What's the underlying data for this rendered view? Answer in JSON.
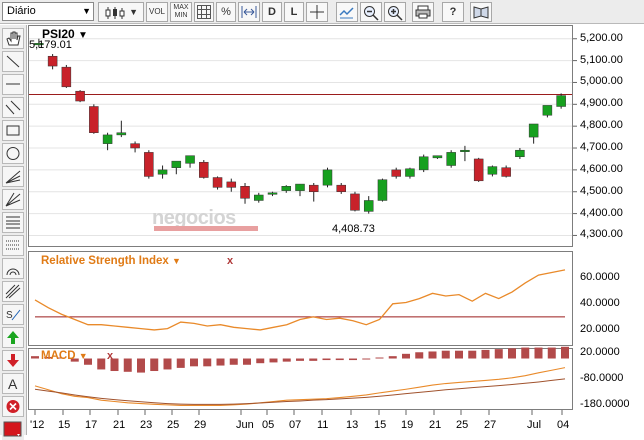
{
  "toolbar": {
    "period_select": "Diário",
    "vol_label": "VOL",
    "maxmin_label_top": "MAX",
    "maxmin_label_bottom": "MIN",
    "percent_label": "%",
    "d_label": "D",
    "l_label": "L",
    "help_label": "?"
  },
  "symbol": "PSI20",
  "last_price": "5,179.01",
  "min_price_label": "4,408.73",
  "watermark": "negocios",
  "rsi": {
    "title": "Relative Strength Index",
    "close": "x"
  },
  "macd": {
    "title": "MACD",
    "close": "x"
  },
  "colors": {
    "up": "#17a01f",
    "down": "#c8222a",
    "rsi_line": "#e98a2a",
    "level_line": "#9b1c1c",
    "macd_bar": "#b24a4a"
  },
  "price_axis": [
    "5,200.00",
    "5,100.00",
    "5,000.00",
    "4,900.00",
    "4,800.00",
    "4,700.00",
    "4,600.00",
    "4,500.00",
    "4,400.00",
    "4,300.00"
  ],
  "rsi_axis": [
    "60.0000",
    "40.0000",
    "20.0000"
  ],
  "macd_axis": [
    "20.0000",
    "-80.0000",
    "-180.0000"
  ],
  "x_axis": [
    "'12",
    "15",
    "17",
    "21",
    "23",
    "25",
    "29",
    "Jun",
    "05",
    "07",
    "11",
    "13",
    "15",
    "19",
    "21",
    "25",
    "27",
    "Jul",
    "04"
  ],
  "chart_data": {
    "type": "candlestick",
    "ylim": [
      4270,
      5240
    ],
    "reference_level": 4945,
    "candles": [
      {
        "o": 5175,
        "h": 5200,
        "l": 5160,
        "c": 5179
      },
      {
        "o": 5120,
        "h": 5130,
        "l": 5060,
        "c": 5075
      },
      {
        "o": 5070,
        "h": 5080,
        "l": 4975,
        "c": 4980
      },
      {
        "o": 4960,
        "h": 4965,
        "l": 4910,
        "c": 4915
      },
      {
        "o": 4890,
        "h": 4900,
        "l": 4765,
        "c": 4770
      },
      {
        "o": 4720,
        "h": 4770,
        "l": 4690,
        "c": 4760
      },
      {
        "o": 4760,
        "h": 4825,
        "l": 4750,
        "c": 4770
      },
      {
        "o": 4720,
        "h": 4730,
        "l": 4680,
        "c": 4700
      },
      {
        "o": 4680,
        "h": 4690,
        "l": 4560,
        "c": 4570
      },
      {
        "o": 4580,
        "h": 4620,
        "l": 4560,
        "c": 4600
      },
      {
        "o": 4610,
        "h": 4630,
        "l": 4580,
        "c": 4640
      },
      {
        "o": 4630,
        "h": 4660,
        "l": 4610,
        "c": 4665
      },
      {
        "o": 4635,
        "h": 4645,
        "l": 4560,
        "c": 4565
      },
      {
        "o": 4565,
        "h": 4570,
        "l": 4510,
        "c": 4520
      },
      {
        "o": 4545,
        "h": 4560,
        "l": 4500,
        "c": 4520
      },
      {
        "o": 4525,
        "h": 4540,
        "l": 4445,
        "c": 4470
      },
      {
        "o": 4460,
        "h": 4495,
        "l": 4450,
        "c": 4485
      },
      {
        "o": 4490,
        "h": 4500,
        "l": 4480,
        "c": 4495
      },
      {
        "o": 4505,
        "h": 4530,
        "l": 4495,
        "c": 4525
      },
      {
        "o": 4505,
        "h": 4535,
        "l": 4480,
        "c": 4535
      },
      {
        "o": 4530,
        "h": 4540,
        "l": 4455,
        "c": 4500
      },
      {
        "o": 4530,
        "h": 4610,
        "l": 4520,
        "c": 4600
      },
      {
        "o": 4530,
        "h": 4540,
        "l": 4490,
        "c": 4500
      },
      {
        "o": 4490,
        "h": 4500,
        "l": 4410,
        "c": 4415
      },
      {
        "o": 4410,
        "h": 4480,
        "l": 4400,
        "c": 4460
      },
      {
        "o": 4460,
        "h": 4560,
        "l": 4455,
        "c": 4555
      },
      {
        "o": 4600,
        "h": 4610,
        "l": 4560,
        "c": 4570
      },
      {
        "o": 4570,
        "h": 4610,
        "l": 4560,
        "c": 4605
      },
      {
        "o": 4600,
        "h": 4670,
        "l": 4590,
        "c": 4660
      },
      {
        "o": 4655,
        "h": 4665,
        "l": 4650,
        "c": 4665
      },
      {
        "o": 4620,
        "h": 4690,
        "l": 4610,
        "c": 4680
      },
      {
        "o": 4690,
        "h": 4710,
        "l": 4640,
        "c": 4690
      },
      {
        "o": 4650,
        "h": 4655,
        "l": 4545,
        "c": 4550
      },
      {
        "o": 4580,
        "h": 4620,
        "l": 4570,
        "c": 4615
      },
      {
        "o": 4610,
        "h": 4620,
        "l": 4565,
        "c": 4570
      },
      {
        "o": 4660,
        "h": 4700,
        "l": 4650,
        "c": 4690
      },
      {
        "o": 4750,
        "h": 4780,
        "l": 4720,
        "c": 4810
      },
      {
        "o": 4850,
        "h": 4880,
        "l": 4840,
        "c": 4895
      },
      {
        "o": 4890,
        "h": 4950,
        "l": 4880,
        "c": 4940
      }
    ],
    "rsi": {
      "ylim": [
        10,
        72
      ],
      "level": 30,
      "values": [
        43,
        37,
        32,
        28,
        24,
        24,
        23,
        22,
        21,
        20,
        21,
        26,
        25,
        23,
        24,
        22,
        21,
        20,
        22,
        24,
        28,
        30,
        28,
        29,
        27,
        24,
        28,
        40,
        41,
        44,
        48,
        46,
        47,
        42,
        48,
        44,
        49,
        56,
        62,
        64,
        66
      ]
    },
    "macd": {
      "ylim": [
        -190,
        25
      ],
      "bars": [
        3,
        2,
        0,
        -4,
        -8,
        -14,
        -16,
        -17,
        -18,
        -16,
        -14,
        -12,
        -10,
        -10,
        -9,
        -8,
        -8,
        -6,
        -5,
        -4,
        -3,
        -3,
        -2,
        -2,
        -2,
        -1,
        0,
        3,
        6,
        8,
        9,
        10,
        10,
        10,
        11,
        12,
        13,
        14,
        14,
        14,
        15
      ],
      "macd_line": [
        -105,
        -120,
        -135,
        -145,
        -150,
        -160,
        -165,
        -170,
        -173,
        -176,
        -178,
        -180,
        -180,
        -180,
        -180,
        -178,
        -175,
        -170,
        -165,
        -160,
        -158,
        -156,
        -154,
        -150,
        -145,
        -140,
        -132,
        -125,
        -118,
        -110,
        -102,
        -96,
        -92,
        -88,
        -84,
        -80,
        -74,
        -66,
        -55,
        -45,
        -35
      ],
      "signal_line": [
        -118,
        -125,
        -132,
        -140,
        -147,
        -153,
        -158,
        -162,
        -166,
        -170,
        -173,
        -175,
        -176,
        -176,
        -176,
        -175,
        -173,
        -171,
        -168,
        -165,
        -163,
        -160,
        -158,
        -155,
        -152,
        -149,
        -145,
        -140,
        -135,
        -130,
        -125,
        -120,
        -116,
        -112,
        -108,
        -104,
        -100,
        -95,
        -90,
        -84,
        -78
      ]
    }
  }
}
